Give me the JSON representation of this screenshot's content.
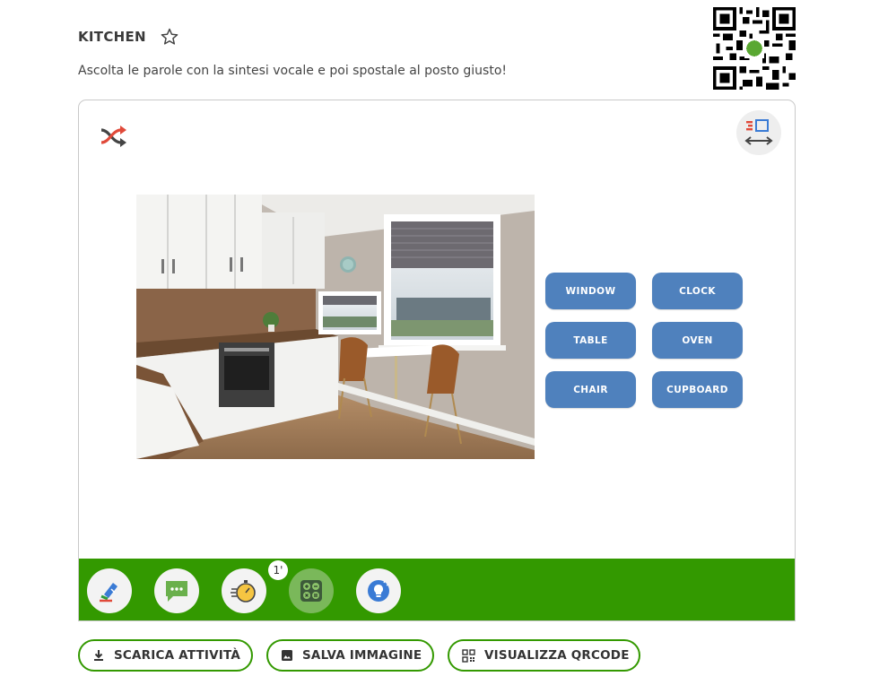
{
  "header": {
    "title": "KITCHEN",
    "subtitle": "Ascolta le parole con la sintesi vocale e poi spostale al posto giusto!"
  },
  "activity": {
    "words": [
      "WINDOW",
      "CLOCK",
      "TABLE",
      "OVEN",
      "CHAIR",
      "CUPBOARD"
    ]
  },
  "toolbar": {
    "tools": [
      "highlighter",
      "chat",
      "timer",
      "calculator",
      "lightbulb"
    ],
    "timer_badge": "1'"
  },
  "actions": {
    "download_label": "SCARICA ATTIVITÀ",
    "save_image_label": "SALVA IMMAGINE",
    "qrcode_label": "VISUALIZZA QRCODE"
  },
  "colors": {
    "toolbar_green": "#339900",
    "word_blue": "#4f81bd",
    "button_border": "#339900"
  }
}
